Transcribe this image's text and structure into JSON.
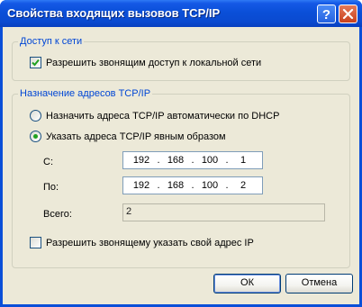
{
  "window": {
    "title": "Свойства входящих вызовов TCP/IP",
    "help_label": "?",
    "close_label": "✕"
  },
  "network_access": {
    "group_label": "Доступ к сети",
    "allow_local_network": {
      "label": "Разрешить звонящим доступ к локальной сети",
      "checked": true
    }
  },
  "address_assignment": {
    "group_label": "Назначение адресов TCP/IP",
    "dhcp_option": {
      "label": "Назначить адреса TCP/IP автоматически по DHCP",
      "selected": false
    },
    "explicit_option": {
      "label": "Указать адреса TCP/IP явным образом",
      "selected": true
    },
    "from_label": "С:",
    "from_ip": [
      "192",
      "168",
      "100",
      "1"
    ],
    "to_label": "По:",
    "to_ip": [
      "192",
      "168",
      "100",
      "2"
    ],
    "total_label": "Всего:",
    "total_value": "2",
    "allow_caller_ip": {
      "label": "Разрешить звонящему указать свой адрес IP",
      "checked": false
    }
  },
  "buttons": {
    "ok": "ОК",
    "cancel": "Отмена"
  }
}
